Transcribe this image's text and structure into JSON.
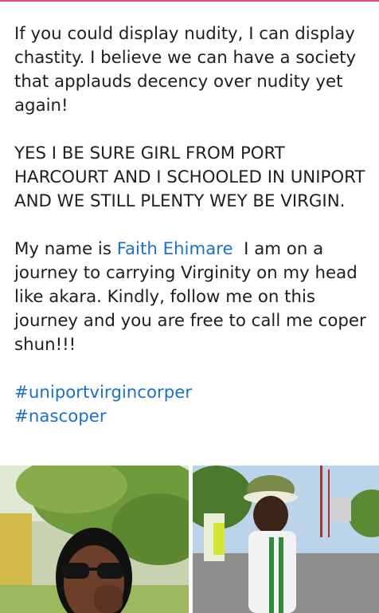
{
  "post": {
    "paragraph1": "If you could display nudity, I can display chastity. I believe we can have a society that applauds decency over nudity yet again!",
    "paragraph2": "YES I BE SURE GIRL FROM PORT HARCOURT AND I SCHOOLED IN UNIPORT AND WE STILL PLENTY WEY BE VIRGIN.",
    "paragraph3_before": "My name is ",
    "mention": "Faith Ehimare",
    "paragraph3_after": "  I am on a journey to carrying Virginity on my head like akara. Kindly, follow me on this journey and you are free to call me coper shun!!!",
    "hashtags": [
      "#uniportvirgincorper",
      "#nascoper"
    ]
  },
  "colors": {
    "accent_bar": "#e0457b",
    "link": "#1a6fd4",
    "text": "#1c1e21"
  },
  "photos": [
    {
      "name": "photo-selfie",
      "icon": "person-with-sunglasses-image"
    },
    {
      "name": "photo-corper-uniform",
      "icon": "person-in-nysc-uniform-image"
    }
  ]
}
